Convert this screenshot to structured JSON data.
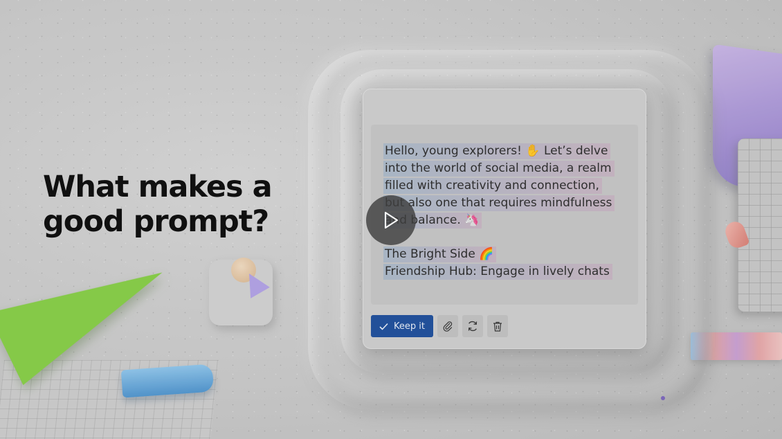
{
  "headline": {
    "line1": "What makes a",
    "line2": "good prompt?"
  },
  "card": {
    "lines": [
      "Hello, young explorers! ✋ Let’s delve",
      "into the world of social media, a realm",
      "filled with creativity and connection,",
      "but also one that requires mindfulness",
      "and balance. 🦄"
    ],
    "section_lines": [
      "The Bright Side  🌈",
      "Friendship Hub: Engage in lively chats"
    ],
    "keep_label": "Keep it"
  },
  "icons": {
    "check": "checkmark-icon",
    "attach": "paperclip-icon",
    "regenerate": "refresh-icon",
    "delete": "trash-icon",
    "play": "play-icon"
  },
  "colors": {
    "keep_button": "#1d4e9c",
    "headline": "#0a0a0a",
    "highlight_start": "#8caacd",
    "highlight_end": "#c8a0be"
  }
}
